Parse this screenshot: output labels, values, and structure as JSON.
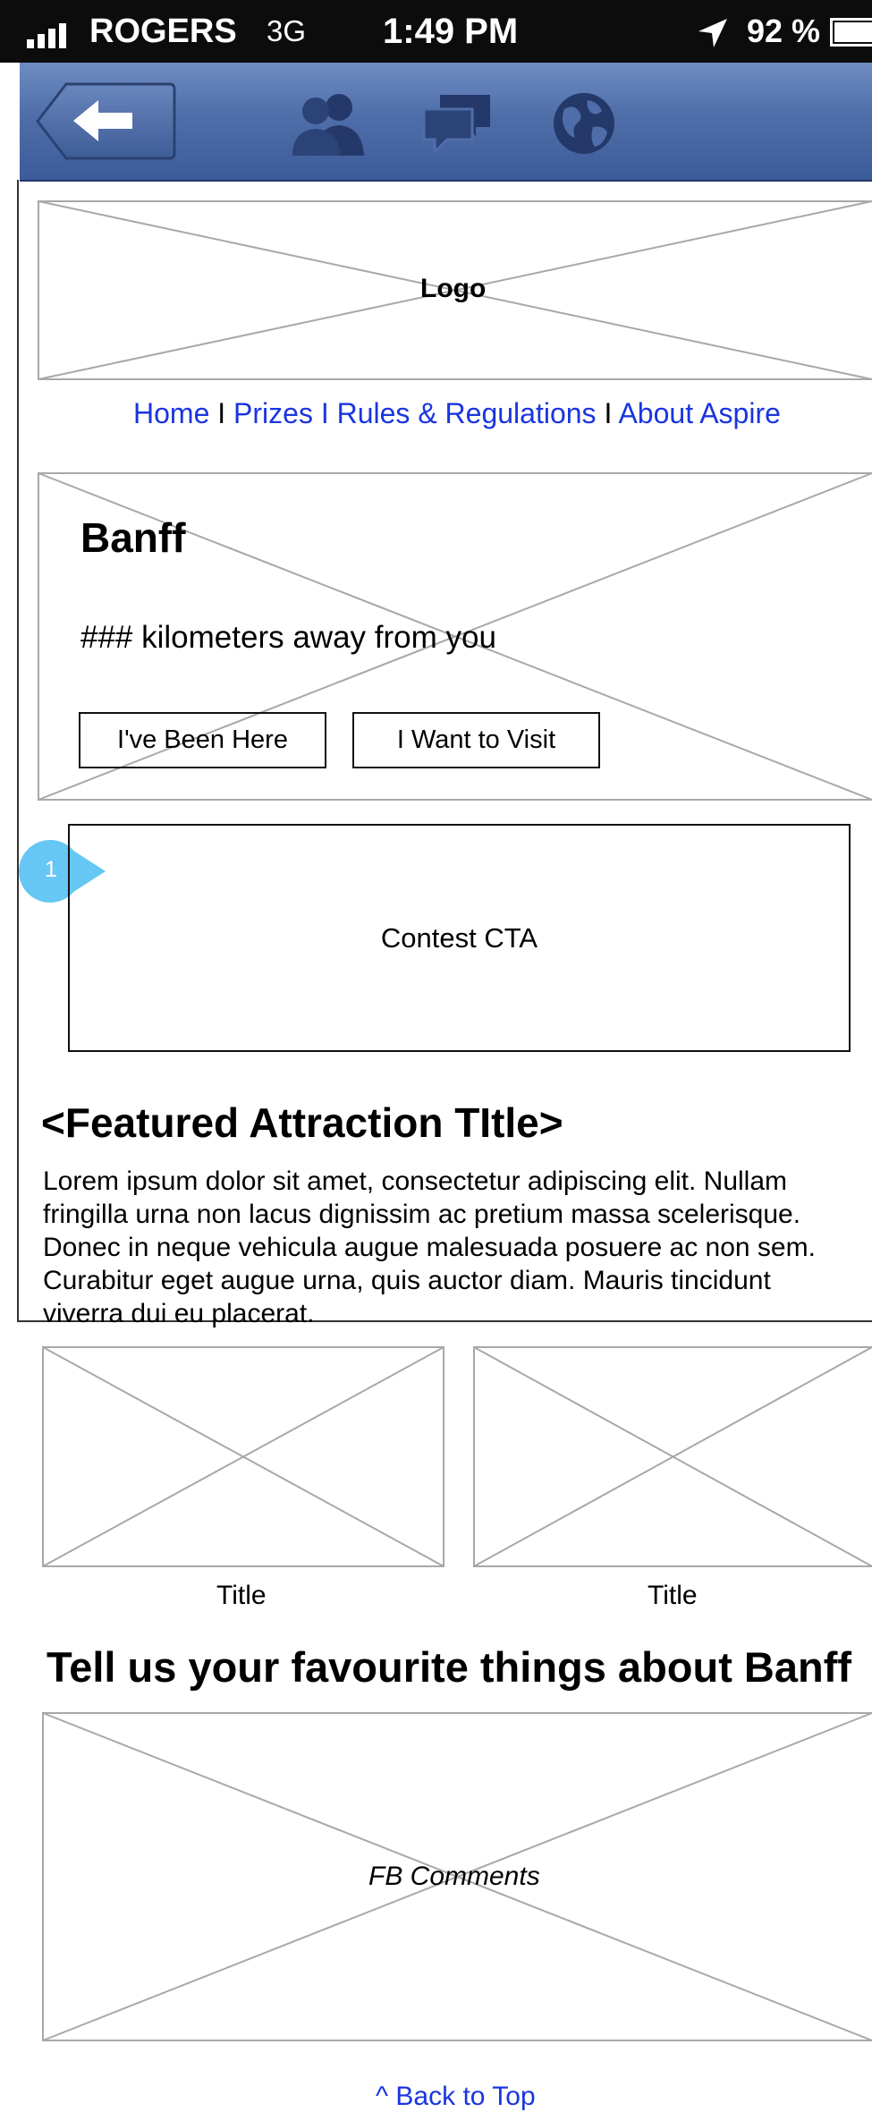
{
  "status_bar": {
    "carrier": "ROGERS",
    "network": "3G",
    "time": "1:49 PM",
    "battery": "92 %"
  },
  "fb_bar": {
    "back_icon": "back-arrow-icon",
    "icons": [
      "friends-icon",
      "messages-icon",
      "globe-icon"
    ]
  },
  "logo": {
    "label": "Logo"
  },
  "nav": {
    "links": [
      "Home",
      "Prizes",
      "Rules & Regulations",
      "About Aspire"
    ],
    "separator": "I"
  },
  "hero": {
    "title": "Banff",
    "distance": "### kilometers away from you",
    "been_here_button": "I've Been Here",
    "want_visit_button": "I Want to Visit"
  },
  "annotation": {
    "number": "1",
    "color": "#66c7f5"
  },
  "contest": {
    "label": "Contest CTA"
  },
  "featured": {
    "title": "<Featured Attraction TItle>",
    "body": [
      "Lorem ipsum dolor sit amet, consectetur adipiscing elit. Nullam",
      "fringilla urna non lacus dignissim ac pretium massa scelerisque.",
      "Donec in neque vehicula augue malesuada posuere ac non sem.",
      "Curabitur eget augue urna, quis auctor diam. Mauris tincidunt",
      "viverra dui eu placerat."
    ]
  },
  "thumbnails": [
    {
      "title": "Title"
    },
    {
      "title": "Title"
    }
  ],
  "comments": {
    "heading": "Tell us your favourite things about Banff",
    "placeholder_label": "FB Comments"
  },
  "footer": {
    "back_to_top": "^ Back to Top"
  },
  "colors": {
    "link": "#1a35e0",
    "fb_bar": "#4f6ea9",
    "placeholder_stroke": "#a8a8a8"
  }
}
